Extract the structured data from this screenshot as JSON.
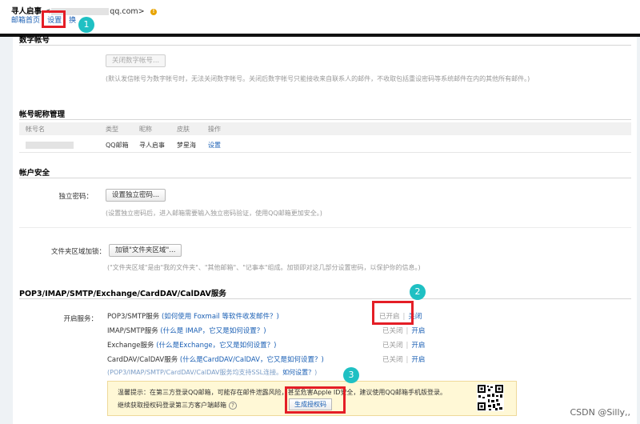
{
  "header": {
    "user_name": "寻人启事",
    "email_prefix": "<",
    "email_suffix": "qq.com>",
    "warn_glyph": "!",
    "nav": [
      {
        "label": "邮箱首页"
      },
      {
        "label": "设置"
      },
      {
        "label": "换"
      }
    ],
    "nav_sep": "|"
  },
  "digital_account": {
    "title": "数字帐号",
    "button": "关闭数字帐号...",
    "hint": "(默认发信帐号为数字帐号时，无法关闭数字帐号。关闭后数字帐号只能接收来自联系人的邮件，不收取包括重设密码等系统邮件在内的其他所有邮件。)"
  },
  "alias": {
    "title": "帐号昵称管理",
    "columns": [
      "帐号名",
      "类型",
      "昵称",
      "皮肤",
      "操作"
    ],
    "row": {
      "type": "QQ邮箱",
      "nickname": "寻人启事",
      "skin": "梦星海",
      "action": "设置"
    }
  },
  "security": {
    "title": "帐户安全",
    "pwd_label": "独立密码：",
    "pwd_button": "设置独立密码...",
    "pwd_hint": "(设置独立密码后，进入邮箱需要输入独立密码验证，使用QQ邮箱更加安全。)",
    "folder_label": "文件夹区域加锁：",
    "folder_button": "加锁\"文件夹区域\"...",
    "folder_hint": "(\"文件夹区域\"是由\"我的文件夹\"、\"其他邮箱\"、\"记事本\"组成。加锁即对这几部分设置密码，以保护你的信息。)"
  },
  "services": {
    "title": "POP3/IMAP/SMTP/Exchange/CardDAV/CalDAV服务",
    "label": "开启服务：",
    "separator": "|",
    "rows": [
      {
        "name": "POP3/SMTP服务",
        "question": "(如何使用 Foxmail 等软件收发邮件？)",
        "status": "已开启",
        "action": "关闭"
      },
      {
        "name": "IMAP/SMTP服务",
        "question": "(什么是 IMAP，它又是如何设置？)",
        "status": "已关闭",
        "action": "开启"
      },
      {
        "name": "Exchange服务",
        "question": "(什么是Exchange，它又是如何设置？)",
        "status": "已关闭",
        "action": "开启"
      },
      {
        "name": "CardDAV/CalDAV服务",
        "question": "(什么是CardDAV/CalDAV，它又是如何设置？)",
        "status": "已关闭",
        "action": "开启"
      }
    ],
    "ssl_note": "(POP3/IMAP/SMTP/CardDAV/CalDAV服务均支持SSL连接。",
    "ssl_link": "如何设置？",
    "ssl_close": ")"
  },
  "tip": {
    "line1": "温馨提示：在第三方登录QQ邮箱，可能存在邮件泄露风险，甚至危害Apple ID安全，建议使用QQ邮箱手机版登录。",
    "line2": "继续获取授权码登录第三方客户端邮箱",
    "help_glyph": "?",
    "generate_button": "生成授权码"
  },
  "annotations": {
    "b1": "1",
    "b2": "2",
    "b3": "3"
  },
  "watermark": "CSDN @Silly,,",
  "colors": {
    "link": "#1a5fb4",
    "highlight": "#e41e26",
    "bubble": "#1fc0c3",
    "tip_bg": "#fff8d6"
  }
}
